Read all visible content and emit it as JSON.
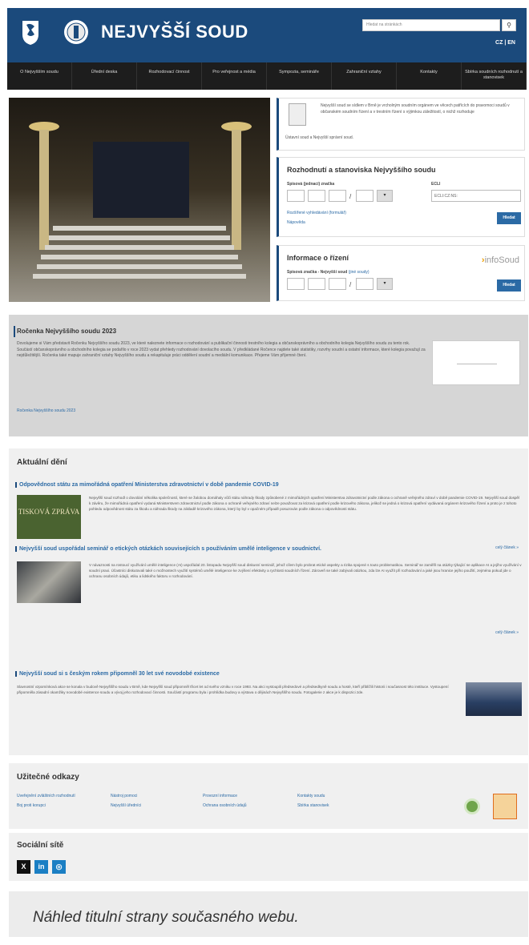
{
  "header": {
    "title": "NEJVYŠŠÍ SOUD",
    "search_placeholder": "Hledat na stránkách",
    "search_icon": "search-icon",
    "lang_cz": "CZ",
    "lang_sep": "|",
    "lang_en": "EN"
  },
  "nav": [
    "O Nejvyšším soudu",
    "Úřední deska",
    "Rozhodovací činnost",
    "Pro veřejnost a média",
    "Sympozia, semináře",
    "Zahraniční vztahy",
    "Kontakty",
    "Sbírka soudních rozhodnutí a stanovisek"
  ],
  "intro": {
    "text": "Nejvyšší soud se sídlem v Brně je vrcholným soudním orgánem ve věcech patřících do pravomoci soudů v občanském soudním řízení a v trestním řízení s výjimkou záležitostí, o nichž rozhoduje",
    "text2": "Ústavní soud a Nejvyšší správní soud."
  },
  "decisions": {
    "title": "Rozhodnutí a stanoviska Nejvyššího soudu",
    "file_label": "Spisová (jednací) značka",
    "ecli_label": "ECLI",
    "ecli_value": "ECLI:CZ:NS:",
    "sep": "/",
    "link1": "Rozšířené vyhledávání (formulář)",
    "link2": "Nápověda",
    "button": "Hledat"
  },
  "info": {
    "title": "Informace o řízení",
    "label": "Spisová značka - Nejvyšší soud",
    "label_link": "(jiné soudy)",
    "logo": "infoSoud",
    "button": "Hledat"
  },
  "yearbook": {
    "title": "Ročenka Nejvyššího soudu 2023",
    "text": "Dovolujeme si Vám představit Ročenku Nejvyššího soudu 2023, ve které naleznete informace o rozhodování a publikační činnosti trestního kolegia a občanskoprávního a obchodního kolegia Nejvyššího soudu za tento rok. Součástí občanskoprávního a obchodního kolegia se podařilo v roce 2023 vydat přehledy rozhodování dovolacího soudu. V předkládané Ročence najdete také statistiky, rozvrhy soudní a ostatní informace, které kolegia považují za nejdůležitější. Ročenka také mapuje zahraniční vztahy Nejvyššího soudu a rekapituluje práci oddělení soudní a mediální komunikace. Přejeme Vám příjemné čtení.",
    "link": "Ročenka Nejvyššího soudu 2023"
  },
  "news": {
    "heading": "Aktuální dění",
    "a1": {
      "title": "Odpovědnost státu za mimořádná opatření Ministerstva zdravotnictví v době pandemie COVID-19",
      "img_text": "TISKOVÁ ZPRÁVA",
      "text": "Nejvyšší soud rozhodl o dovolání několika společností, které se žalobou domáhaly vůči státu náhrady škody způsobené z mimořádných opatření Ministerstva zdravotnictví podle zákona o ochraně veřejného zdraví v době pandemie COVID-19. Nejvyšší soud dospěl k závěru, že mimořádná opatření vydaná Ministerstvem zdravotnictví podle zákona o ochraně veřejného zdraví nelze považovat za krizová opatření podle krizového zákona, jelikož se jedná o krizová opatření vydávaná orgánem krizového řízení a proto je z tohoto pohledu odpovědnost státu za škodu a náhrada škody na základě krizového zákona, který by byl v opačném případě posuzován podle zákona o odpovědnosti státu.",
      "more": "celý článek »"
    },
    "a2": {
      "title": "Nejvyšší soud uspořádal seminář o etických otázkách souvisejících s používáním umělé inteligence v soudnictví.",
      "text": "V návaznosti na rostoucí využívání umělé inteligence (AI) uspořádal 20. listopadu Nejvyšší soud diskusní seminář, jehož cílem bylo probrat etické aspekty a rizika spojené s touto problematikou. Seminář se zaměřil na otázky týkající se aplikace AI a jejího využívání v soudní praxi. Účastníci diskutovali také o možnostech využití systémů umělé inteligence ke zvýšení efektivity a rychlosti soudních řízení. Zároveň se také zabývali otázkou, zda lze AI využít při rozhodování a jaké jsou hranice jejího použití, zejména pokud jde o ochranu osobních údajů, etiku a lidského faktoru v rozhodování.",
      "more": "celý článek »"
    },
    "a3": {
      "title": "Nejvyšší soud si s českým rokem připomněl 30 let své novodobé existence",
      "text": "Slavnostní vzpomínková akce se konala v budově Nejvyššího soudu v Brně, kde Nejvyšší soud připomněl třicet let od svého vzniku v roce 1993. Na akci vystoupili předsedové a předsedkyně soudu a hosté, kteří přiblížili historii i současnost této instituce. Vystoupení připomněla zásadní okamžiky novodobé existence soudu a vývoj jeho rozhodovací činnosti. Součástí programu byla i prohlídka budovy a výstava o dějinách Nejvyššího soudu. Fotogalerie z akce je k dispozici zde."
    }
  },
  "links": {
    "heading": "Užitečné odkazy",
    "items": [
      "Uveřejnění zvláštních rozhodnutí",
      "Boj proti korupci",
      "Nástroj pomoci",
      "Nejvyšší úředníci",
      "Provozní informace",
      "Ochrana osobních údajů",
      "Kontakty soudu",
      "Sbírka stanovisek"
    ]
  },
  "social": {
    "heading": "Sociální sítě",
    "x": "X",
    "in": "in",
    "ig": "◎"
  },
  "caption": "Náhled titulní strany současného webu."
}
